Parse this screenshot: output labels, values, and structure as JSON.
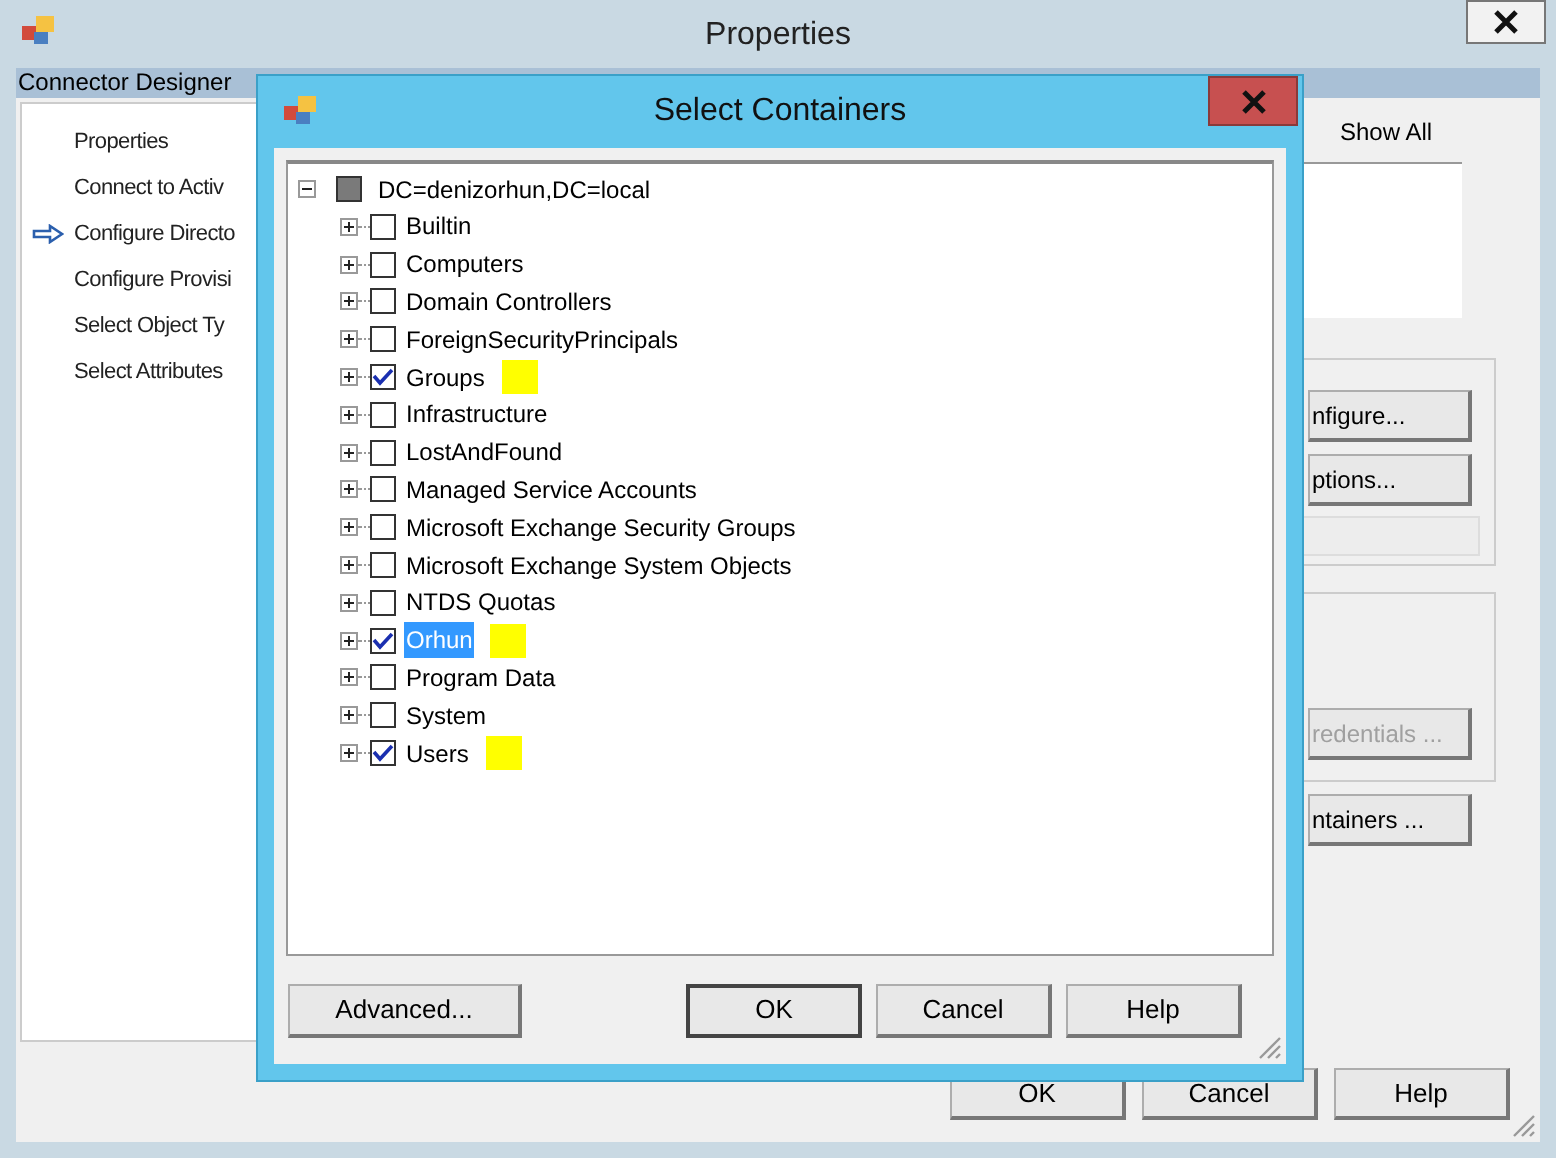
{
  "window": {
    "title": "Properties"
  },
  "designer": {
    "header": "Connector Designer",
    "steps": [
      {
        "label": "Properties",
        "current": false
      },
      {
        "label": "Connect to Activ",
        "current": false
      },
      {
        "label": "Configure Directo",
        "current": true
      },
      {
        "label": "Configure Provisi",
        "current": false
      },
      {
        "label": "Select Object Ty",
        "current": false
      },
      {
        "label": "Select Attributes",
        "current": false
      }
    ]
  },
  "right_panel": {
    "show_all": {
      "label": "Show All"
    },
    "buttons": [
      {
        "label": "nfigure...",
        "disabled": false
      },
      {
        "label": "ptions...",
        "disabled": false
      },
      {
        "label": "redentials ...",
        "disabled": true
      },
      {
        "label": "ntainers ...",
        "disabled": false
      }
    ]
  },
  "dialog": {
    "title": "Select Containers",
    "root": {
      "label": "DC=denizorhun,DC=local",
      "expanded": true,
      "partial": true,
      "children": [
        {
          "label": "Builtin",
          "checked": false,
          "selected": false,
          "marked": false,
          "expanded": false
        },
        {
          "label": "Computers",
          "checked": false,
          "selected": false,
          "marked": false,
          "expanded": false
        },
        {
          "label": "Domain Controllers",
          "checked": false,
          "selected": false,
          "marked": false,
          "expanded": false
        },
        {
          "label": "ForeignSecurityPrincipals",
          "checked": false,
          "selected": false,
          "marked": false,
          "expanded": false
        },
        {
          "label": "Groups",
          "checked": true,
          "selected": false,
          "marked": true,
          "expanded": false
        },
        {
          "label": "Infrastructure",
          "checked": false,
          "selected": false,
          "marked": false,
          "expanded": false
        },
        {
          "label": "LostAndFound",
          "checked": false,
          "selected": false,
          "marked": false,
          "expanded": false
        },
        {
          "label": "Managed Service Accounts",
          "checked": false,
          "selected": false,
          "marked": false,
          "expanded": false
        },
        {
          "label": "Microsoft Exchange Security Groups",
          "checked": false,
          "selected": false,
          "marked": false,
          "expanded": false
        },
        {
          "label": "Microsoft Exchange System Objects",
          "checked": false,
          "selected": false,
          "marked": false,
          "expanded": false
        },
        {
          "label": "NTDS Quotas",
          "checked": false,
          "selected": false,
          "marked": false,
          "expanded": false
        },
        {
          "label": "Orhun",
          "checked": true,
          "selected": true,
          "marked": true,
          "expanded": false
        },
        {
          "label": "Program Data",
          "checked": false,
          "selected": false,
          "marked": false,
          "expanded": false
        },
        {
          "label": "System",
          "checked": false,
          "selected": false,
          "marked": false,
          "expanded": false
        },
        {
          "label": "Users",
          "checked": true,
          "selected": false,
          "marked": true,
          "expanded": false
        }
      ]
    },
    "buttons": [
      {
        "label": "Advanced...",
        "default": false
      },
      {
        "label": "OK",
        "default": true
      },
      {
        "label": "Cancel",
        "default": false
      },
      {
        "label": "Help",
        "default": false
      }
    ]
  },
  "buttons": [
    "OK",
    "Cancel",
    "Help"
  ]
}
